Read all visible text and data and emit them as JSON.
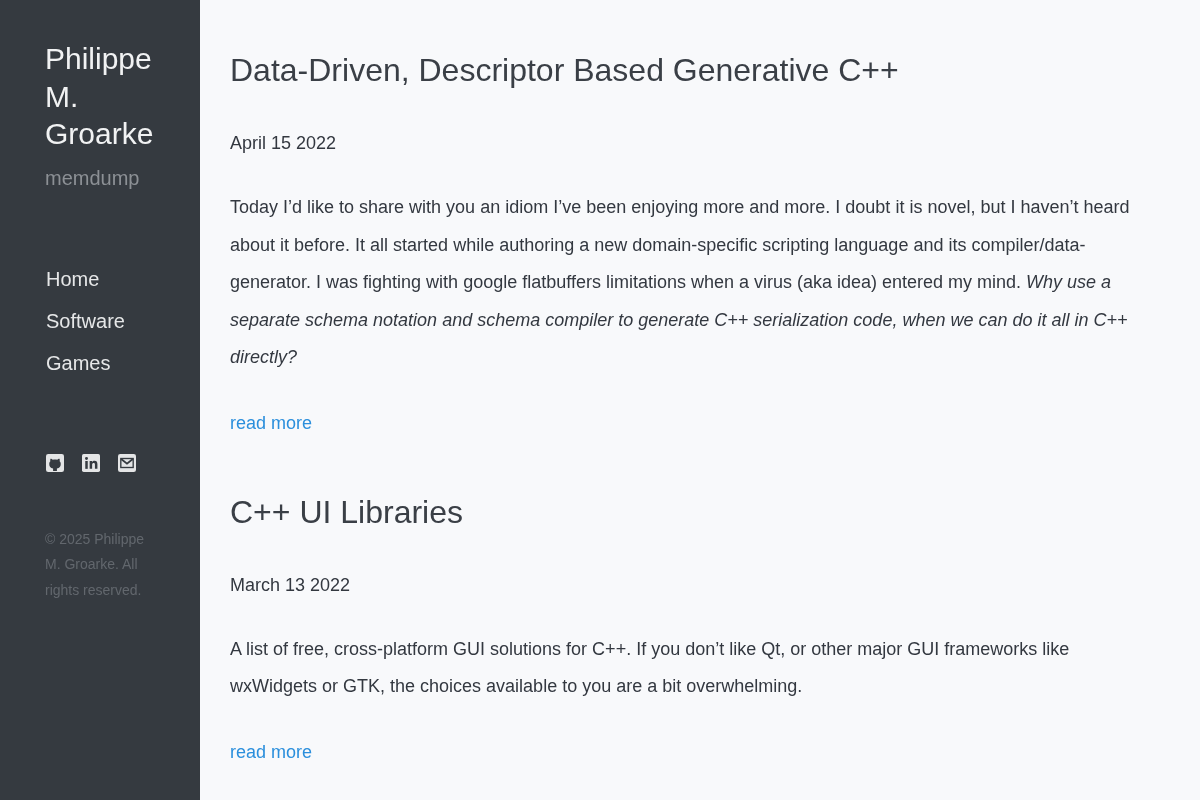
{
  "sidebar": {
    "title": "Philippe M. Groarke",
    "subtitle": "memdump",
    "nav": [
      "Home",
      "Software",
      "Games"
    ],
    "social_links": [
      {
        "kind": "github"
      },
      {
        "kind": "linkedin"
      },
      {
        "kind": "email"
      }
    ],
    "copyright": "© 2025 Philippe M. Groarke. All rights reserved."
  },
  "posts": [
    {
      "title": "Data-Driven, Descriptor Based Generative C++",
      "date": "April 15 2022",
      "excerpt": "Today I’d like to share with you an idiom I’ve been enjoying more and more. I doubt it is novel, but I haven’t heard about it before. It all started while authoring a new domain-specific scripting language and its compiler/data-generator. I was fighting with google flatbuffers limitations when a virus (aka idea) entered my mind. *Why use a separate schema notation and schema compiler to generate C++ serialization code, when we can do it all in C++ directly?*",
      "link": "read more"
    },
    {
      "title": "C++ UI Libraries",
      "date": "March 13 2022",
      "excerpt": "A list of free, cross-platform GUI solutions for C++. If you don’t like Qt, or other major GUI frameworks like wxWidgets or GTK, the choices available to you are a bit overwhelming.",
      "link": "read more"
    }
  ]
}
